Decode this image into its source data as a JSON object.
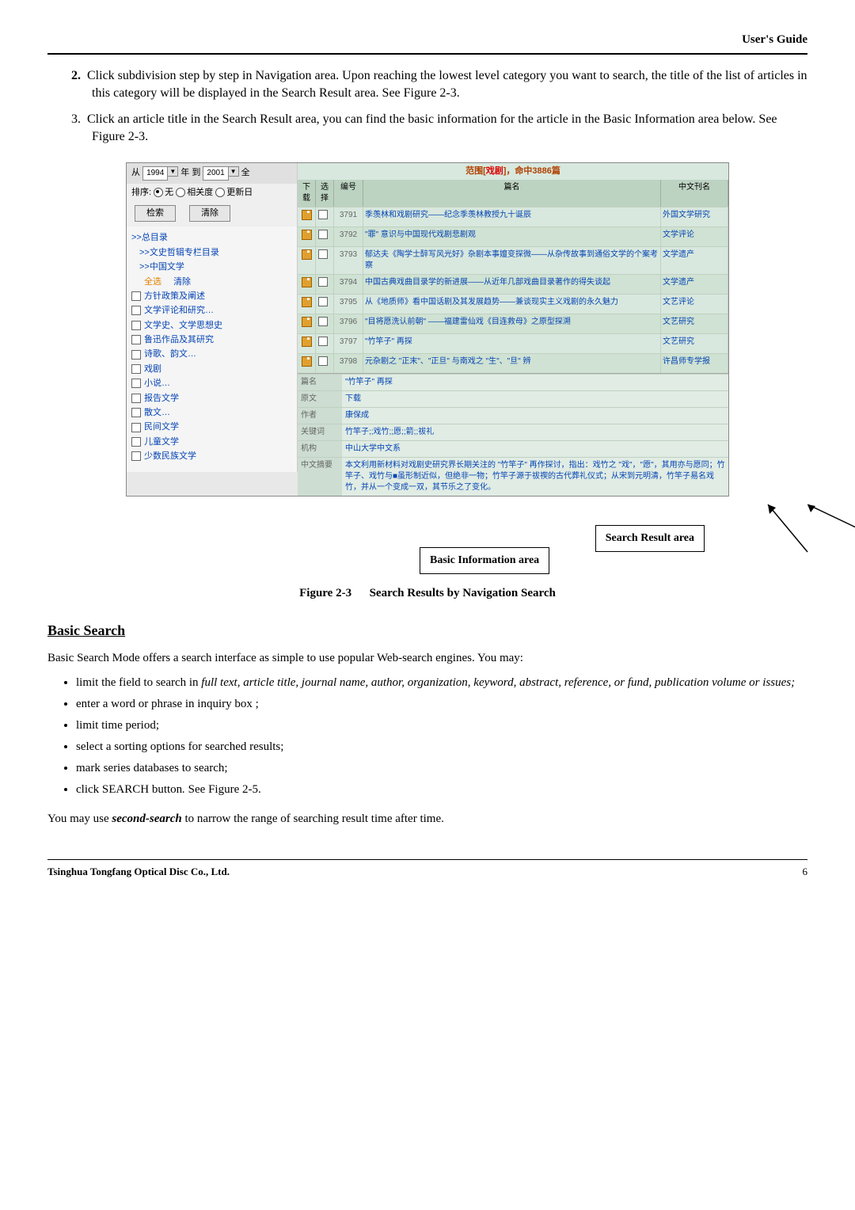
{
  "header": {
    "right": "User's Guide"
  },
  "steps": {
    "s2_num": "2.",
    "s2": "Click subdivision step by step in Navigation area. Upon reaching the lowest level category you want to search, the title of the list of articles in this category will be displayed in the Search Result area. See Figure 2-3.",
    "s3_num": "3.",
    "s3": "Click an article title in the Search Result area, you can find the basic information for the article in the Basic Information area below. See Figure 2-3."
  },
  "shot": {
    "date_from": "1994",
    "date_to": "2001",
    "year_label": "年",
    "to_label": "到",
    "all_label": "全",
    "from_label": "从",
    "sort_prefix": "排序:",
    "radios": {
      "none": "无",
      "rel": "相关度",
      "date": "更新日"
    },
    "btn_search": "检索",
    "btn_clear": "清除",
    "tree": {
      "root": ">>总目录",
      "node1": ">>文史哲辑专栏目录",
      "node2": ">>中国文学",
      "act_all": "全选",
      "act_clear": "清除",
      "items": [
        "方针政策及阐述",
        "文学评论和研究…",
        "文学史、文学思想史",
        "鲁迅作品及其研究",
        "诗歌、韵文…",
        "戏剧",
        "小说…",
        "报告文学",
        "散文…",
        "民间文学",
        "儿童文学",
        "少数民族文学"
      ]
    },
    "range_p1": "范围[",
    "range_red": "戏剧",
    "range_p2": "]，命中3886篇",
    "thead": {
      "c1": "下载",
      "c2": "选择",
      "c3": "编号",
      "c4": "篇名",
      "c5": "中文刊名"
    },
    "rows": [
      {
        "n": "3791",
        "title": "季羡林和戏剧研究——纪念季羡林教授九十诞辰",
        "j": "外国文学研究"
      },
      {
        "n": "3792",
        "title": "\"罪\" 意识与中国现代戏剧悲剧观",
        "j": "文学评论"
      },
      {
        "n": "3793",
        "title": "郁达夫《陶学士醉写风光好》杂剧本事嬗变探微——从杂传故事到通俗文学的个案考察",
        "j": "文学遗产"
      },
      {
        "n": "3794",
        "title": "中国古典戏曲目录学的新进展——从近年几部戏曲目录著作的得失谈起",
        "j": "文学遗产"
      },
      {
        "n": "3795",
        "title": "从《地质师》看中国话剧及其发展趋势——兼谈现实主义戏剧的永久魅力",
        "j": "文艺评论"
      },
      {
        "n": "3796",
        "title": "\"目将愿洗认前朝\" ——福建雷仙戏《目连救母》之原型探溯",
        "j": "文艺研究"
      },
      {
        "n": "3797",
        "title": "\"竹竿子\" 再探",
        "j": "文艺研究"
      },
      {
        "n": "3798",
        "title": "元杂剧之 \"正末\"、\"正旦\" 与南戏之 \"生\"、\"旦\" 辨",
        "j": "许昌师专学报"
      }
    ],
    "detail": {
      "t_title": "篇名",
      "v_title": "\"竹竿子\" 再探",
      "t_src": "原文",
      "v_src": "下载",
      "t_author": "作者",
      "v_author": "康保成",
      "t_kw": "关键词",
      "v_kw": "竹竿子;;戏竹;;愿;;箭;;祓礼",
      "t_org": "机构",
      "v_org": "中山大学中文系",
      "t_abs": "中文摘要",
      "v_abs": "本文利用新材料对戏剧史研究界长期关注的 \"竹竿子\" 再作探讨，指出：戏竹之 \"戏\"，\"愿\"，其用亦与愿同；竹竿子、戏竹与■虽形制近似，但绝非一物；竹竿子源于祓禊的古代葬礼仪式；从宋到元明清，竹竿子易名戏竹，并从一个变成一双，其节乐之了变化。"
    },
    "callout1": "Search Result area",
    "callout2": "Basic Information area"
  },
  "fig_caption_num": "Figure 2-3",
  "fig_caption_txt": "Search Results by Navigation Search",
  "basic_search": {
    "title": "Basic Search",
    "intro": "Basic Search Mode offers a search interface as simple to use popular Web-search engines. You may:",
    "b1_a": "limit the field to search in ",
    "b1_i": "full text",
    "b1_b": ", ",
    "b1_i2": "article title, journal name, author, organization, keyword, abstract, reference, or fund, publication volume or issues;",
    "b2": "enter a word or phrase in inquiry box ;",
    "b3": "limit time period;",
    "b4": "select a sorting options for searched results;",
    "b5": "mark series databases to search;",
    "b6_a": "click SEARCH button",
    "b6_i": ".",
    "b6_b": " See Figure 2-5.",
    "outro_a": "You may use ",
    "outro_b": "second-search",
    "outro_c": " to narrow the range of searching result time after time."
  },
  "footer": {
    "company": "Tsinghua Tongfang Optical Disc Co., Ltd.",
    "page": "6"
  }
}
